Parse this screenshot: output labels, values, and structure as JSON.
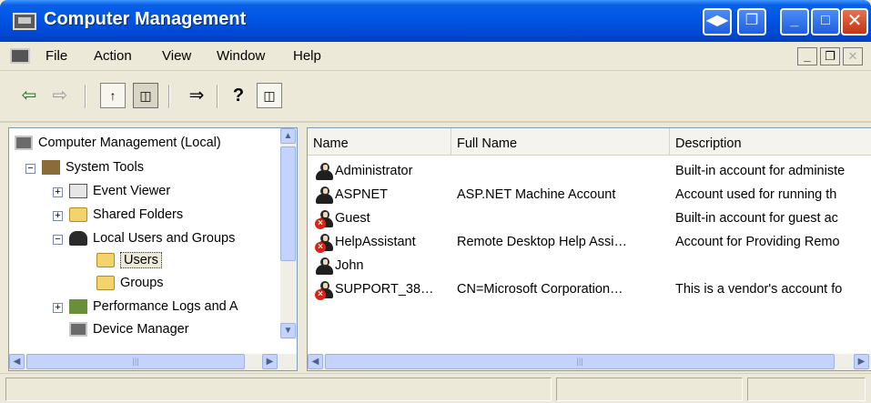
{
  "window": {
    "title": "Computer Management",
    "buttons": {
      "back_icon": "◀▶",
      "restore_icon": "❐",
      "minimize_icon": "_",
      "maximize_icon": "□",
      "close_icon": "✕"
    }
  },
  "menu": {
    "items": [
      "File",
      "Action",
      "View",
      "Window",
      "Help"
    ],
    "mdi": {
      "minimize": "_",
      "restore": "❐",
      "close": "✕"
    }
  },
  "toolbar": {
    "back_icon": "⇦",
    "forward_icon": "⇨",
    "up_icon": "↑",
    "tree_icon": "◫",
    "export_icon": "⇒",
    "help_icon": "?",
    "view_icon": "◫"
  },
  "tree": {
    "items": [
      {
        "label": "Computer Management (Local)"
      },
      {
        "label": "System Tools"
      },
      {
        "label": "Event Viewer"
      },
      {
        "label": "Shared Folders"
      },
      {
        "label": "Local Users and Groups"
      },
      {
        "label": "Users"
      },
      {
        "label": "Groups"
      },
      {
        "label": "Performance Logs and A"
      },
      {
        "label": "Device Manager"
      }
    ]
  },
  "list": {
    "columns": [
      "Name",
      "Full Name",
      "Description"
    ],
    "rows": [
      {
        "name": "Administrator",
        "full_name": "",
        "description": "Built-in account for administe",
        "disabled": false
      },
      {
        "name": "ASPNET",
        "full_name": "ASP.NET Machine Account",
        "description": "Account used for running th",
        "disabled": false
      },
      {
        "name": "Guest",
        "full_name": "",
        "description": "Built-in account for guest ac",
        "disabled": true
      },
      {
        "name": "HelpAssistant",
        "full_name": "Remote Desktop Help Assi…",
        "description": "Account for Providing Remo",
        "disabled": true
      },
      {
        "name": "John",
        "full_name": "",
        "description": "",
        "disabled": false
      },
      {
        "name": "SUPPORT_38…",
        "full_name": "CN=Microsoft Corporation…",
        "description": "This is a vendor's account fo",
        "disabled": true
      }
    ]
  },
  "scroll": {
    "left": "◀",
    "right": "▶",
    "up": "▲",
    "down": "▼",
    "grip": "|||"
  },
  "colors": {
    "titlebar": "#0055e5",
    "disabled_marker": "#e02010",
    "folder": "#f3d36b"
  }
}
